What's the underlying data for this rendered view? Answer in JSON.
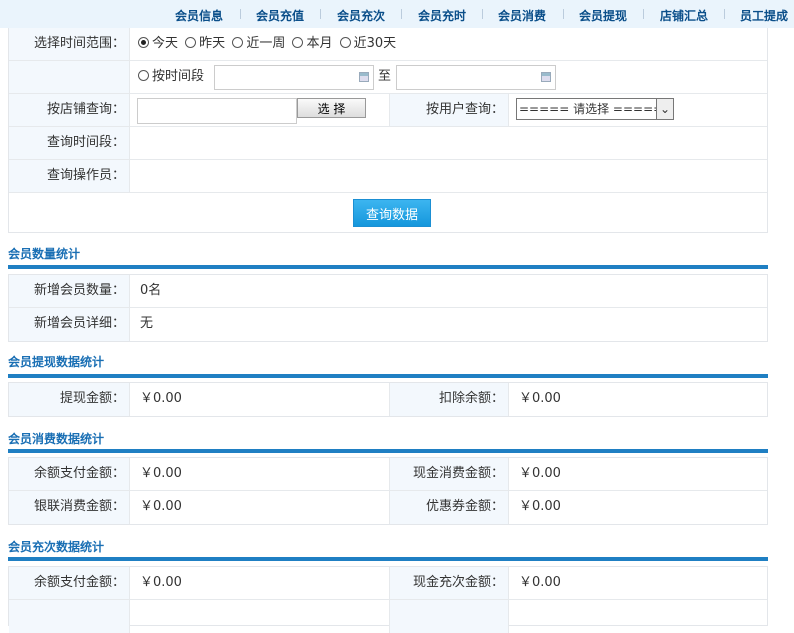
{
  "nav": [
    "会员信息",
    "会员充值",
    "会员充次",
    "会员充时",
    "会员消费",
    "会员提现",
    "店铺汇总",
    "员工提成"
  ],
  "query": {
    "time_range_label": "选择时间范围：",
    "time_options": [
      "今天",
      "昨天",
      "近一周",
      "本月",
      "近30天"
    ],
    "selected_option": "今天",
    "by_period_label": "按时间段",
    "to_label": "至",
    "start_date": "",
    "end_date": "",
    "store_label": "按店铺查询：",
    "store_value": "",
    "select_button": "选 择",
    "user_label": "按用户查询：",
    "user_select": "===== 请选择 =====",
    "period_label": "查询时间段：",
    "operator_label": "查询操作员：",
    "submit": "查询数据"
  },
  "sections": {
    "count": {
      "title": "会员数量统计",
      "new_count_label": "新增会员数量：",
      "new_count": "0名",
      "new_detail_label": "新增会员详细：",
      "new_detail": "无"
    },
    "withdraw": {
      "title": "会员提现数据统计",
      "amount_label": "提现金额：",
      "amount": "￥0.00",
      "deduct_label": "扣除余额：",
      "deduct": "￥0.00"
    },
    "consume": {
      "title": "会员消费数据统计",
      "balance_label": "余额支付金额：",
      "balance": "￥0.00",
      "cash_label": "现金消费金额：",
      "cash": "￥0.00",
      "unionpay_label": "银联消费金额：",
      "unionpay": "￥0.00",
      "coupon_label": "优惠券金额：",
      "coupon": "￥0.00"
    },
    "recharge": {
      "title": "会员充次数据统计",
      "balance_label": "余额支付金额：",
      "balance": "￥0.00",
      "cash_label": "现金充次金额：",
      "cash": "￥0.00"
    }
  }
}
